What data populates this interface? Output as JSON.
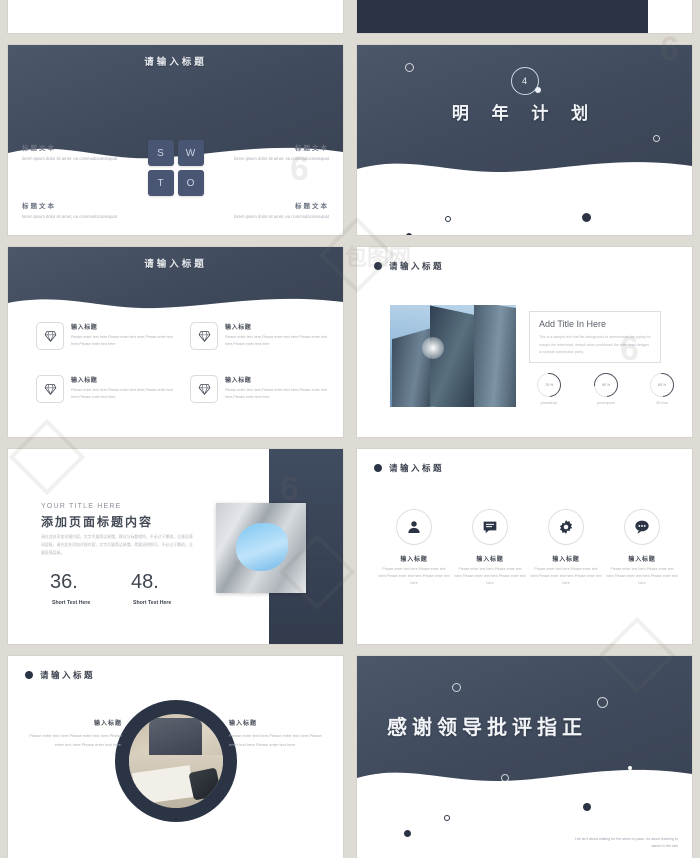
{
  "page": {
    "background_color": "#dedad4",
    "dark_color": "#2b3445",
    "accent_color": "#485673"
  },
  "slides": [
    {
      "id": "swot",
      "title": "请输入标题",
      "swot_letters": [
        "S",
        "W",
        "T",
        "O"
      ],
      "blocks": [
        {
          "title": "标题文本",
          "desc": "lorem ipsum dolor sit amet, ea commodoconsequat"
        },
        {
          "title": "标题文本",
          "desc": "lorem ipsum dolor sit amet, ea commodoconsequat"
        },
        {
          "title": "标题文本",
          "desc": "lorem ipsum dolor sit amet, ea commodoconsequat"
        },
        {
          "title": "标题文本",
          "desc": "lorem ipsum dolor sit amet, ea commodoconsequat"
        }
      ]
    },
    {
      "id": "section",
      "number": "4",
      "title": "明 年 计 划"
    },
    {
      "id": "features",
      "title": "请输入标题",
      "items": [
        {
          "icon": "diamond-icon",
          "title": "输入标题",
          "desc": "Please enter text here,Please enter text here,Please enter text here,Please enter text here"
        },
        {
          "icon": "diamond-icon",
          "title": "输入标题",
          "desc": "Please enter text here,Please enter text here,Please enter text here,Please enter text here"
        },
        {
          "icon": "diamond-icon",
          "title": "输入标题",
          "desc": "Please enter text here,Please enter text here,Please enter text here,Please enter text here"
        },
        {
          "icon": "diamond-icon",
          "title": "输入标题",
          "desc": "Please enter text here,Please enter text here,Please enter text here,Please enter text here"
        }
      ]
    },
    {
      "id": "image-stats",
      "title": "请输入标题",
      "box_title": "Add Title In Here",
      "box_text": "This is a sample text that fits background to demonstrate the typing for margin the letterhead, default when positioned the letterhead designs to sample contribution party.",
      "stats": [
        {
          "value": "75 %",
          "label": "photoshop"
        },
        {
          "value": "90 %",
          "label": "powerpoint"
        },
        {
          "value": "80 %",
          "label": "3D max"
        }
      ]
    },
    {
      "id": "title-numbers",
      "eyebrow": "YOUR TITLE HERE",
      "title": "添加页面标题内容",
      "paragraph": "请在此处添加详细内容，文字尽量简洁易懂，建议与标题相符，不必过于繁琐。注意段落间层级，请在此处添加详细内容，文字尽量简洁易懂，简要说明即可，不必过于繁琐，注意段落层级。",
      "numbers": [
        {
          "value": "36.",
          "label": "Short Text Here"
        },
        {
          "value": "48.",
          "label": "Short Text Here"
        }
      ]
    },
    {
      "id": "four-icons",
      "title": "请输入标题",
      "items": [
        {
          "icon": "user-icon",
          "title": "输入标题",
          "desc": "Please enter text here,Please enter text here,Please enter text here,Please enter text here"
        },
        {
          "icon": "message-box-icon",
          "title": "输入标题",
          "desc": "Please enter text here,Please enter text here,Please enter text here,Please enter text here"
        },
        {
          "icon": "gear-icon",
          "title": "输入标题",
          "desc": "Please enter text here,Please enter text here,Please enter text here,Please enter text here"
        },
        {
          "icon": "speech-bubble-icon",
          "title": "输入标题",
          "desc": "Please enter text here,Please enter text here,Please enter text here,Please enter text here"
        }
      ]
    },
    {
      "id": "round-photo",
      "title": "请输入标题",
      "left": {
        "title": "输入标题",
        "desc": "Please enter text here.Please enter text here.Please enter text here.Please enter text here."
      },
      "right": {
        "title": "输入标题",
        "desc": "Please enter text here.Please enter text here.Please enter text here.Please enter text here."
      }
    },
    {
      "id": "thanks",
      "title": "感谢领导批评指正",
      "quote": "Life isn't about waiting for the storm to pass, it's about learning to dance in the rain"
    }
  ],
  "watermark": {
    "logo": "6",
    "text": "包图网"
  }
}
